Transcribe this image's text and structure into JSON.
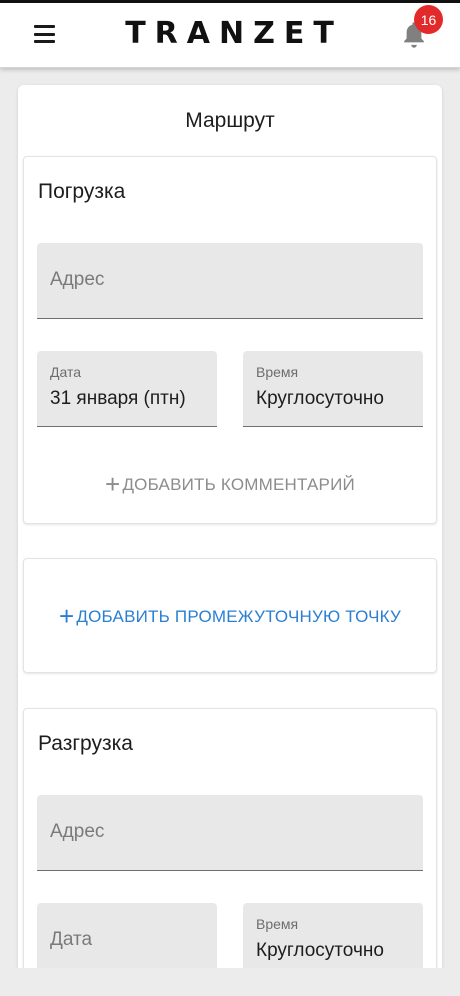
{
  "header": {
    "logo": "TRANZET",
    "notifications_count": "16",
    "menu_icon": "hamburger-menu-icon",
    "bell_icon": "bell-icon"
  },
  "route": {
    "title": "Маршрут",
    "loading": {
      "title": "Погрузка",
      "address_placeholder": "Адрес",
      "date_label": "Дата",
      "date_value": "31 января (птн)",
      "time_label": "Время",
      "time_value": "Круглосуточно",
      "add_comment": "Добавить комментарий"
    },
    "add_waypoint": "Добавить промежуточную точку",
    "unloading": {
      "title": "Разгрузка",
      "address_placeholder": "Адрес",
      "date_placeholder": "Дата",
      "time_label": "Время",
      "time_value": "Круглосуточно"
    }
  },
  "colors": {
    "accent": "#2a7fd4",
    "badge": "#e32a2a"
  }
}
